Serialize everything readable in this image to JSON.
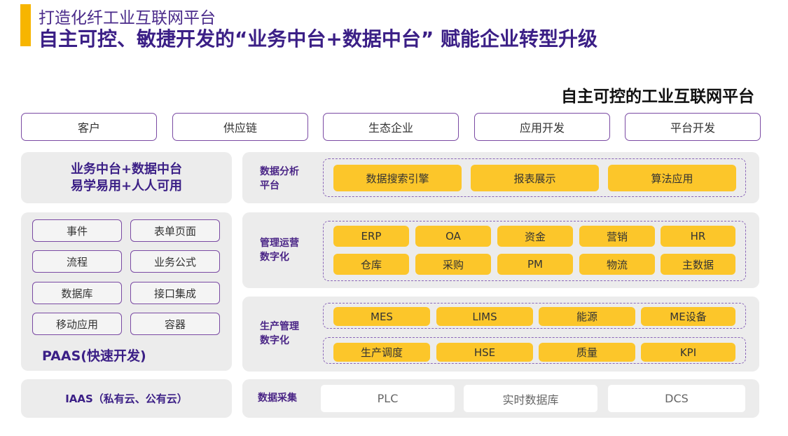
{
  "header": {
    "subtitle": "打造化纤工业互联网平台",
    "title": "自主可控、敏捷开发的“业务中台+数据中台” 赋能企业转型升级",
    "platform_title": "自主可控的工业互联网平台"
  },
  "top_boxes": [
    "客户",
    "供应链",
    "生态企业",
    "应用开发",
    "平台开发"
  ],
  "left": {
    "middle_platform": {
      "line1": "业务中台+数据中台",
      "line2": "易学易用+人人可用"
    },
    "paas": {
      "items": [
        "事件",
        "表单页面",
        "流程",
        "业务公式",
        "数据库",
        "接口集成",
        "移动应用",
        "容器"
      ],
      "label": "PAAS(快速开发)"
    },
    "iaas": "IAAS（私有云、公有云）"
  },
  "data_analysis": {
    "label_line1": "数据分析",
    "label_line2": "平台",
    "items": [
      "数据搜索引擎",
      "报表展示",
      "算法应用"
    ]
  },
  "management": {
    "label_line1": "管理运营",
    "label_line2": "数字化",
    "row1": [
      "ERP",
      "OA",
      "资金",
      "营销",
      "HR"
    ],
    "row2": [
      "仓库",
      "采购",
      "PM",
      "物流",
      "主数据"
    ]
  },
  "production": {
    "label_line1": "生产管理",
    "label_line2": "数字化",
    "row1": [
      "MES",
      "LIMS",
      "能源",
      "ME设备"
    ],
    "row2": [
      "生产调度",
      "HSE",
      "质量",
      "KPI"
    ]
  },
  "collection": {
    "label": "数据采集",
    "items": [
      "PLC",
      "实时数据库",
      "DCS"
    ]
  },
  "colors": {
    "accent": "#f7b500",
    "title": "#3b1f86",
    "yellow": "#fcc62a",
    "purple_border": "#7a4aa3",
    "panel": "#ececec"
  }
}
